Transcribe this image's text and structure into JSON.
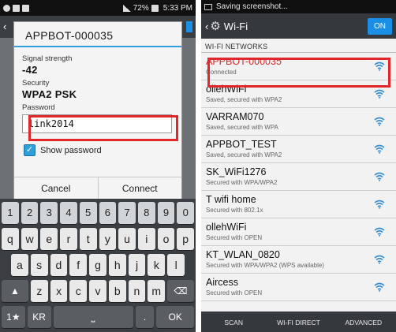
{
  "left": {
    "status_bar": {
      "right_text": "72%",
      "time": "5:33 PM"
    },
    "dialog": {
      "title": "APPBOT-000035",
      "signal_label": "Signal strength",
      "signal_value": "-42",
      "security_label": "Security",
      "security_value": "WPA2 PSK",
      "password_label": "Password",
      "password_value": "link2014",
      "show_password_label": "Show password",
      "show_password_checked": true,
      "cancel_label": "Cancel",
      "connect_label": "Connect"
    },
    "keyboard": {
      "row_numbers": [
        "1",
        "2",
        "3",
        "4",
        "5",
        "6",
        "7",
        "8",
        "9",
        "0"
      ],
      "row1": [
        "q",
        "w",
        "e",
        "r",
        "t",
        "y",
        "u",
        "i",
        "o",
        "p"
      ],
      "row2": [
        "a",
        "s",
        "d",
        "f",
        "g",
        "h",
        "j",
        "k",
        "l"
      ],
      "row3": [
        "z",
        "x",
        "c",
        "v",
        "b",
        "n",
        "m"
      ],
      "bottom_left": "1★",
      "lang": "KR",
      "period": ".",
      "ok": "OK"
    }
  },
  "right": {
    "status_text": "Saving screenshot...",
    "header": {
      "title": "Wi-Fi",
      "toggle": "ON"
    },
    "section_label": "WI-FI NETWORKS",
    "networks": [
      {
        "name": "APPBOT-000035",
        "status": "Connected",
        "connected": true
      },
      {
        "name": "ollehWiFi",
        "status": "Saved, secured with WPA2"
      },
      {
        "name": "VARRAM070",
        "status": "Saved, secured with WPA"
      },
      {
        "name": "APPBOT_TEST",
        "status": "Saved, secured with WPA2"
      },
      {
        "name": "SK_WiFi1276",
        "status": "Secured with WPA/WPA2"
      },
      {
        "name": "T wifi home",
        "status": "Secured with 802.1x"
      },
      {
        "name": "ollehWiFi",
        "status": "Secured with OPEN"
      },
      {
        "name": "KT_WLAN_0820",
        "status": "Secured with WPA/WPA2 (WPS available)"
      },
      {
        "name": "Aircess",
        "status": "Secured with OPEN"
      }
    ],
    "bottom": {
      "scan": "SCAN",
      "direct": "WI-FI DIRECT",
      "advanced": "ADVANCED"
    }
  },
  "colors": {
    "accent": "#2e9fd9",
    "highlight": "#e0272b",
    "connected": "#d22b2b",
    "toggle": "#1b8fe6"
  }
}
